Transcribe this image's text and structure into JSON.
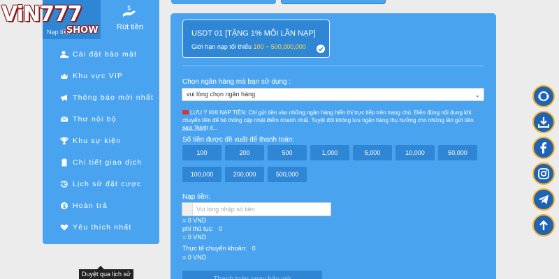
{
  "logo": {
    "brand": "ViN777",
    "suffix": ".SHOW"
  },
  "sidebar": {
    "tab_left": "Nạp tiền",
    "tab_right": "Rút tiền",
    "items": [
      {
        "label": "Cài đặt bảo mật",
        "icon": "user-lock-icon"
      },
      {
        "label": "Khu vực VIP",
        "icon": "crown-icon"
      },
      {
        "label": "Thông báo mới nhất",
        "icon": "megaphone-icon"
      },
      {
        "label": "Thư nội bộ",
        "icon": "mail-icon"
      },
      {
        "label": "Khu sự kiện",
        "icon": "trophy-icon"
      },
      {
        "label": "Chi tiết giao dịch",
        "icon": "clipboard-icon"
      },
      {
        "label": "Lịch sử đặt cược",
        "icon": "history-icon"
      },
      {
        "label": "Hoàn trả",
        "icon": "dollar-circle-icon"
      },
      {
        "label": "Yêu thích nhất",
        "icon": "heart-icon"
      }
    ]
  },
  "tooltip": "Duyệt qua lịch sử",
  "card": {
    "title": "USDT 01 [TẶNG 1% MỖI LẦN NẠP]",
    "limit_prefix": "Giới hạn nạp tối thiểu",
    "limit_value": "100 ~ 500,000,000"
  },
  "bank": {
    "label": "Chọn ngân hàng mà bạn sử dụng :",
    "placeholder": "vui lòng chọn ngân hàng"
  },
  "notice": {
    "text": "LƯU Ý KHI NẠP TIỀN: Chỉ gửi tiền vào những ngân hàng hiển thị trực tiếp trên trang chủ. Điền đúng nội dung khi chuyển tiền để hệ thống cập nhật điểm nhanh nhất. Tuyệt đối không lưu ngân hàng thụ hưởng cho những lần gửi tiền sau. Tuyệt đ...",
    "more": "Xem Thêm"
  },
  "suggest": {
    "label": "Số tiền được đề xuất để thanh toán:",
    "amounts": [
      "100",
      "200",
      "500",
      "1,000",
      "5,000",
      "10,000",
      "50,000",
      "100,000",
      "200,000",
      "500,000"
    ]
  },
  "deposit": {
    "label": "Nạp tiền:",
    "placeholder": "Vui lòng nhập số tiền",
    "vnd1": "= 0 VND",
    "fee_label": "phí thủ tục:",
    "fee_value": "0",
    "vnd2": "= 0 VND",
    "actual_label": "Thực tế chuyển khoản:",
    "actual_value": "0",
    "vnd3": "= 0 VND"
  },
  "pay_button": "Thanh toán ngay bây giờ",
  "social": [
    "support-icon",
    "download-icon",
    "facebook-icon",
    "instagram-icon",
    "telegram-icon",
    "scroll-top-icon"
  ],
  "colors": {
    "panel": "#4aa3ef",
    "dark": "#2f86d4",
    "highlight": "#ffd74a",
    "social_ring": "#ffb21a"
  }
}
